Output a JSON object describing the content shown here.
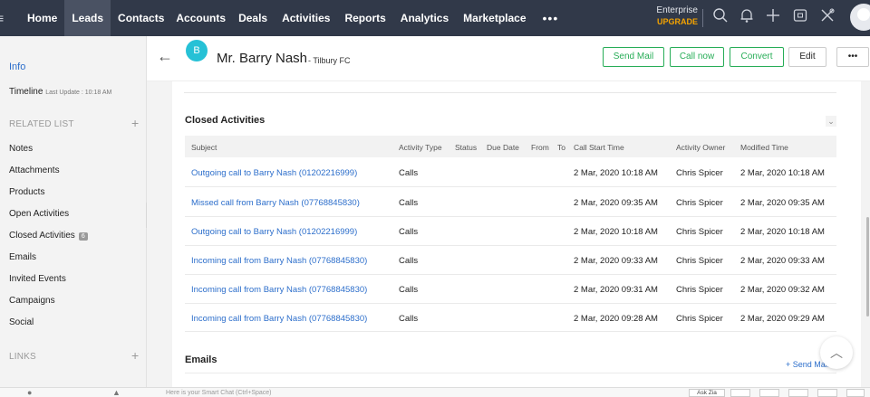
{
  "nav": {
    "items": [
      "Home",
      "Leads",
      "Contacts",
      "Accounts",
      "Deals",
      "Activities",
      "Reports",
      "Analytics",
      "Marketplace"
    ],
    "active": "Leads",
    "more": "•••",
    "edition": "Enterprise",
    "upgrade": "UPGRADE"
  },
  "sidebar": {
    "info": "Info",
    "timeline": "Timeline",
    "timeline_sub": "Last Update : 10:18 AM",
    "related_list": "RELATED LIST",
    "items": [
      "Notes",
      "Attachments",
      "Products",
      "Open Activities",
      "Closed Activities",
      "Emails",
      "Invited Events",
      "Campaigns",
      "Social"
    ],
    "closed_count": "6",
    "links": "LINKS"
  },
  "record": {
    "avatar_letter": "B",
    "name": "Mr. Barry Nash",
    "org": "- Tilbury FC",
    "buttons": [
      "Send Mail",
      "Call now",
      "Convert",
      "Edit",
      "•••"
    ]
  },
  "closed_activities": {
    "title": "Closed Activities",
    "columns": [
      "Subject",
      "Activity Type",
      "Status",
      "Due Date",
      "From",
      "To",
      "Call Start Time",
      "Activity Owner",
      "Modified Time"
    ],
    "rows": [
      {
        "subject": "Outgoing call to Barry Nash (01202216999)",
        "type": "Calls",
        "start": "2 Mar, 2020 10:18 AM",
        "owner": "Chris Spicer",
        "modified": "2 Mar, 2020 10:18 AM"
      },
      {
        "subject": "Missed call from Barry Nash (07768845830)",
        "type": "Calls",
        "start": "2 Mar, 2020 09:35 AM",
        "owner": "Chris Spicer",
        "modified": "2 Mar, 2020 09:35 AM"
      },
      {
        "subject": "Outgoing call to Barry Nash (01202216999)",
        "type": "Calls",
        "start": "2 Mar, 2020 10:18 AM",
        "owner": "Chris Spicer",
        "modified": "2 Mar, 2020 10:18 AM"
      },
      {
        "subject": "Incoming call from Barry Nash (07768845830)",
        "type": "Calls",
        "start": "2 Mar, 2020 09:33 AM",
        "owner": "Chris Spicer",
        "modified": "2 Mar, 2020 09:33 AM"
      },
      {
        "subject": "Incoming call from Barry Nash (07768845830)",
        "type": "Calls",
        "start": "2 Mar, 2020 09:31 AM",
        "owner": "Chris Spicer",
        "modified": "2 Mar, 2020 09:32 AM"
      },
      {
        "subject": "Incoming call from Barry Nash (07768845830)",
        "type": "Calls",
        "start": "2 Mar, 2020 09:28 AM",
        "owner": "Chris Spicer",
        "modified": "2 Mar, 2020 09:29 AM"
      }
    ]
  },
  "emails": {
    "title": "Emails",
    "send_mail": "+ Send Mail"
  },
  "bottom": {
    "chat_placeholder": "Here is your Smart Chat (Ctrl+Space)",
    "ask": "Ask Zia"
  }
}
